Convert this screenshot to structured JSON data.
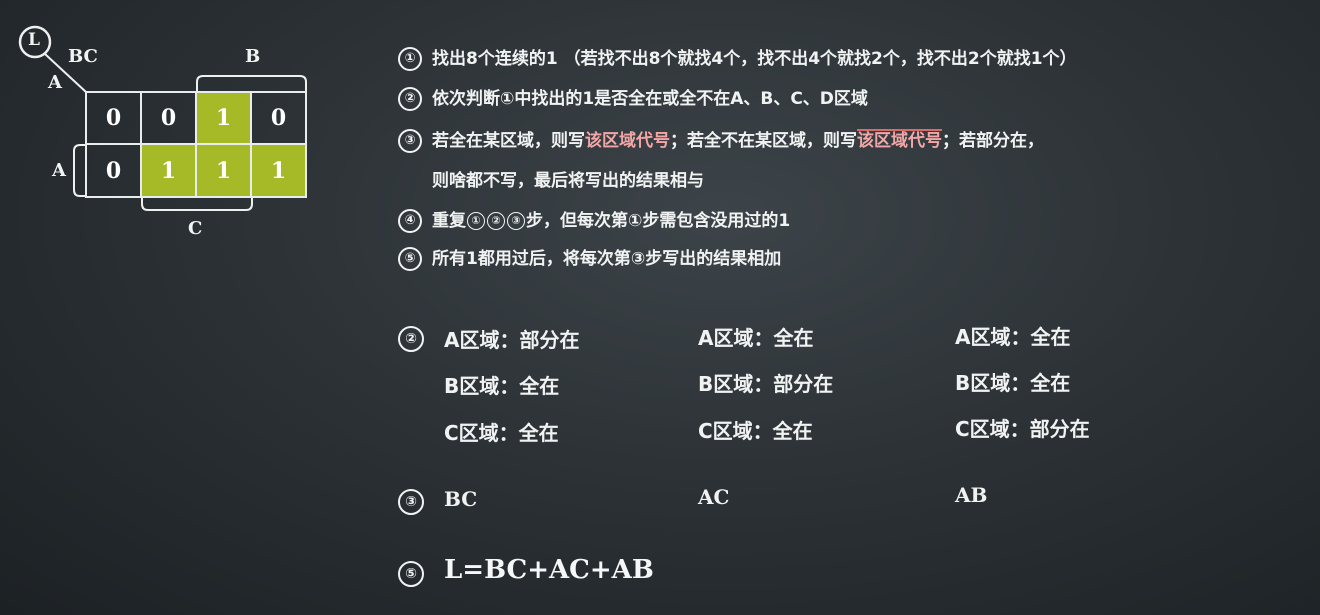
{
  "kmap": {
    "output_label": "L",
    "col_var_label": "BC",
    "row_var_label": "A",
    "group_label_b": "B",
    "group_label_a": "A",
    "group_label_c": "C",
    "rows": [
      [
        "0",
        "0",
        "1",
        "0"
      ],
      [
        "0",
        "1",
        "1",
        "1"
      ]
    ],
    "highlight_color": "#a6b926"
  },
  "steps": [
    {
      "num": "①",
      "text": "找出8个连续的1 （若找不出8个就找4个，找不出4个就找2个，找不出2个就找1个）"
    },
    {
      "num": "②",
      "text": "依次判断①中找出的1是否全在或全不在A、B、C、D区域"
    },
    {
      "num": "③",
      "text_a": "若全在某区域，则写",
      "hl_a": "该区域代号",
      "text_b": "；若全不在某区域，则写",
      "hl_b": "该区域代号",
      "text_c": "；若部分在，",
      "line2": "则啥都不写，最后将写出的结果相与"
    },
    {
      "num": "④",
      "text_a": "重复",
      "c1": "①",
      "c2": "②",
      "c3": "③",
      "text_b": "步，但每次第①步需包含没用过的1"
    },
    {
      "num": "⑤",
      "text": "所有1都用过后，将每次第③步写出的结果相加"
    }
  ],
  "analysis": {
    "marker": "②",
    "columns": [
      [
        "A区域：部分在",
        "B区域：全在",
        "C区域：全在"
      ],
      [
        "A区域：全在",
        "B区域：部分在",
        "C区域：全在"
      ],
      [
        "A区域：全在",
        "B区域：全在",
        "C区域：部分在"
      ]
    ]
  },
  "results": {
    "marker": "③",
    "terms": [
      "BC",
      "AC",
      "AB"
    ]
  },
  "final": {
    "marker": "⑤",
    "expression": "L=BC+AC+AB"
  }
}
